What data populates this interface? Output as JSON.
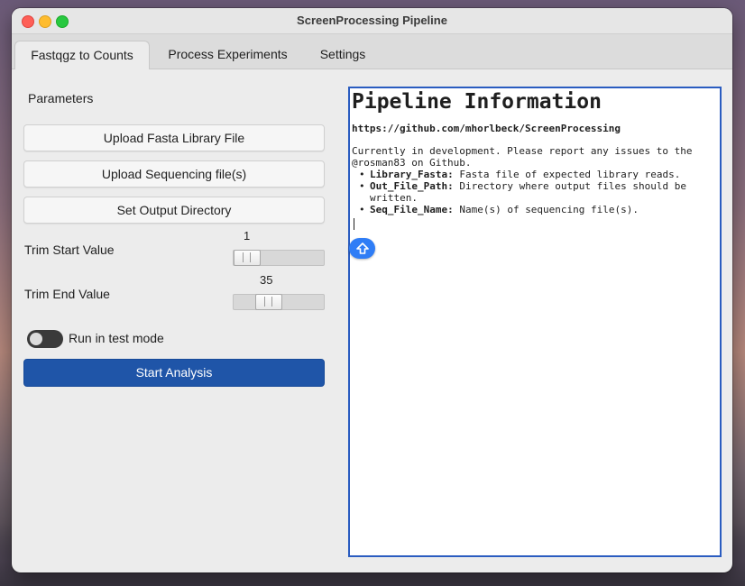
{
  "window": {
    "title": "ScreenProcessing Pipeline"
  },
  "tabs": [
    {
      "label": "Fastqgz to Counts",
      "active": true
    },
    {
      "label": "Process Experiments",
      "active": false
    },
    {
      "label": "Settings",
      "active": false
    }
  ],
  "left": {
    "parameters_label": "Parameters",
    "upload_fasta_label": "Upload Fasta Library File",
    "upload_seq_label": "Upload Sequencing file(s)",
    "set_output_label": "Set Output Directory",
    "trim_start_label": "Trim Start Value",
    "trim_start_value": "1",
    "trim_end_label": "Trim End Value",
    "trim_end_value": "35",
    "test_mode_label": "Run in test mode",
    "test_mode_on": false,
    "start_label": "Start Analysis"
  },
  "info": {
    "title": "Pipeline Information",
    "link": "https://github.com/mhorlbeck/ScreenProcessing",
    "text": "Currently in development. Please report any issues to the @rosman83 on Github.",
    "items": [
      {
        "key": "Library_Fasta:",
        "desc": " Fasta file of expected library reads."
      },
      {
        "key": "Out_File_Path:",
        "desc": " Directory where output files should be written."
      },
      {
        "key": "Seq_File_Name:",
        "desc": " Name(s) of sequencing file(s)."
      }
    ]
  },
  "colors": {
    "accent": "#1f55a8",
    "panel_border": "#2a5cc0",
    "scroll_button": "#2f7df6"
  },
  "icons": {
    "scroll_up": "arrow-up-icon"
  }
}
